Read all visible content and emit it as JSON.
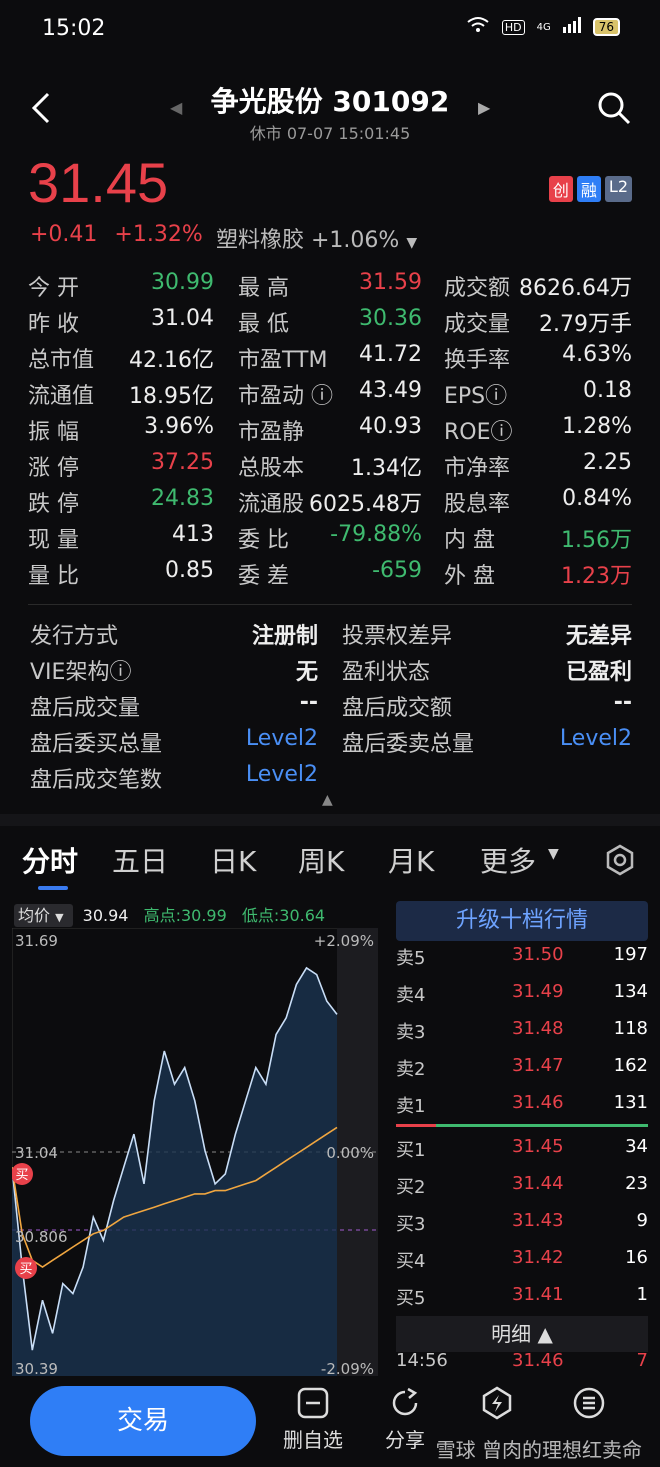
{
  "status": {
    "time": "15:02",
    "battery": "76",
    "net": "4G",
    "hd": "HD"
  },
  "header": {
    "title": "争光股份 301092",
    "subtitle": "休市 07-07 15:01:45"
  },
  "price": {
    "last": "31.45",
    "change": "+0.41",
    "change_pct": "+1.32%",
    "industry": "塑料橡胶 +1.06%"
  },
  "badges": [
    {
      "text": "创",
      "color": "#e8414a"
    },
    {
      "text": "融",
      "color": "#2f7ef6"
    },
    {
      "text": "L2",
      "color": "#5a6b8a"
    }
  ],
  "quote_rows": [
    [
      {
        "l": "今  开",
        "v": "30.99",
        "vc": "green"
      },
      {
        "l": "最  高",
        "v": "31.59",
        "vc": "red"
      },
      {
        "l": "成交额",
        "v": "8626.64万",
        "vc": "white"
      }
    ],
    [
      {
        "l": "昨  收",
        "v": "31.04",
        "vc": "white"
      },
      {
        "l": "最  低",
        "v": "30.36",
        "vc": "green"
      },
      {
        "l": "成交量",
        "v": "2.79万手",
        "vc": "white"
      }
    ],
    [
      {
        "l": "总市值",
        "v": "42.16亿",
        "vc": "white"
      },
      {
        "l": "市盈TTM",
        "v": "41.72",
        "vc": "white"
      },
      {
        "l": "换手率",
        "v": "4.63%",
        "vc": "white"
      }
    ],
    [
      {
        "l": "流通值",
        "v": "18.95亿",
        "vc": "white"
      },
      {
        "l": "市盈动 ⓘ",
        "v": "43.49",
        "vc": "white"
      },
      {
        "l": "EPSⓘ",
        "v": "0.18",
        "vc": "white"
      }
    ],
    [
      {
        "l": "振  幅",
        "v": "3.96%",
        "vc": "white"
      },
      {
        "l": "市盈静",
        "v": "40.93",
        "vc": "white"
      },
      {
        "l": "ROEⓘ",
        "v": "1.28%",
        "vc": "white"
      }
    ],
    [
      {
        "l": "涨  停",
        "v": "37.25",
        "vc": "red"
      },
      {
        "l": "总股本",
        "v": "1.34亿",
        "vc": "white"
      },
      {
        "l": "市净率",
        "v": "2.25",
        "vc": "white"
      }
    ],
    [
      {
        "l": "跌  停",
        "v": "24.83",
        "vc": "green"
      },
      {
        "l": "流通股",
        "v": "6025.48万",
        "vc": "white"
      },
      {
        "l": "股息率",
        "v": "0.84%",
        "vc": "white"
      }
    ],
    [
      {
        "l": "现  量",
        "v": "413",
        "vc": "white"
      },
      {
        "l": "委  比",
        "v": "-79.88%",
        "vc": "green"
      },
      {
        "l": "内  盘",
        "v": "1.56万",
        "vc": "green"
      }
    ],
    [
      {
        "l": "量  比",
        "v": "0.85",
        "vc": "white"
      },
      {
        "l": "委  差",
        "v": "-659",
        "vc": "green"
      },
      {
        "l": "外  盘",
        "v": "1.23万",
        "vc": "red"
      }
    ]
  ],
  "info_rows": [
    [
      {
        "l": "发行方式",
        "v": "注册制",
        "vc": "white"
      },
      {
        "l": "投票权差异",
        "v": "无差异",
        "vc": "white"
      }
    ],
    [
      {
        "l": "VIE架构ⓘ",
        "v": "无",
        "vc": "white"
      },
      {
        "l": "盈利状态",
        "v": "已盈利",
        "vc": "white"
      }
    ],
    [
      {
        "l": "盘后成交量",
        "v": "--",
        "vc": "white"
      },
      {
        "l": "盘后成交额",
        "v": "--",
        "vc": "white"
      }
    ],
    [
      {
        "l": "盘后委买总量",
        "v": "Level2",
        "vc": "blue"
      },
      {
        "l": "盘后委卖总量",
        "v": "Level2",
        "vc": "blue"
      }
    ],
    [
      {
        "l": "盘后成交笔数",
        "v": "Level2",
        "vc": "blue"
      }
    ]
  ],
  "tabs": [
    "分时",
    "五日",
    "日K",
    "周K",
    "月K",
    "更多"
  ],
  "chart_head": {
    "avg_label": "均价",
    "avg_value": "30.94",
    "high": "高点:30.99",
    "low": "低点:30.64"
  },
  "chart_data": {
    "type": "line",
    "y_top_label": "31.69",
    "y_mid_label": "31.04",
    "y_avg_label": "30.806",
    "y_bottom_label": "30.39",
    "pct_top": "+2.09%",
    "pct_mid": "0.00%",
    "pct_bottom": "-2.09%",
    "ylim": [
      30.39,
      31.69
    ],
    "buy_marker": "买",
    "series": [
      {
        "values": [
          31.0,
          30.7,
          30.45,
          30.6,
          30.5,
          30.65,
          30.62,
          30.7,
          30.85,
          30.78,
          30.9,
          31.0,
          31.1,
          30.95,
          31.2,
          31.35,
          31.25,
          31.3,
          31.2,
          31.05,
          30.95,
          30.98,
          31.1,
          31.2,
          31.3,
          31.25,
          31.4,
          31.45,
          31.55,
          31.6,
          31.58,
          31.5,
          31.46
        ]
      },
      {
        "values": [
          31.0,
          30.8,
          30.72,
          30.7,
          30.72,
          30.74,
          30.76,
          30.78,
          30.8,
          30.81,
          30.83,
          30.85,
          30.86,
          30.87,
          30.88,
          30.89,
          30.9,
          30.91,
          30.92,
          30.92,
          30.93,
          30.93,
          30.94,
          30.95,
          30.96,
          30.98,
          31.0,
          31.02,
          31.04,
          31.06,
          31.08,
          31.1,
          31.12
        ]
      }
    ]
  },
  "order_book": {
    "upgrade": "升级十档行情",
    "asks": [
      {
        "k": "卖5",
        "p": "31.50",
        "v": "197"
      },
      {
        "k": "卖4",
        "p": "31.49",
        "v": "134"
      },
      {
        "k": "卖3",
        "p": "31.48",
        "v": "118"
      },
      {
        "k": "卖2",
        "p": "31.47",
        "v": "162"
      },
      {
        "k": "卖1",
        "p": "31.46",
        "v": "131"
      }
    ],
    "bids": [
      {
        "k": "买1",
        "p": "31.45",
        "v": "34"
      },
      {
        "k": "买2",
        "p": "31.44",
        "v": "23"
      },
      {
        "k": "买3",
        "p": "31.43",
        "v": "9"
      },
      {
        "k": "买4",
        "p": "31.42",
        "v": "16"
      },
      {
        "k": "买5",
        "p": "31.41",
        "v": "1"
      }
    ],
    "detail": "明细 ▲",
    "tick": {
      "time": "14:56",
      "price": "31.46",
      "vol": "7"
    }
  },
  "bottom": {
    "trade": "交易",
    "remove_watch": "删自选",
    "share": "分享",
    "alert": "",
    "more": "",
    "watermark": "雪球 曾肉的理想红卖命"
  }
}
